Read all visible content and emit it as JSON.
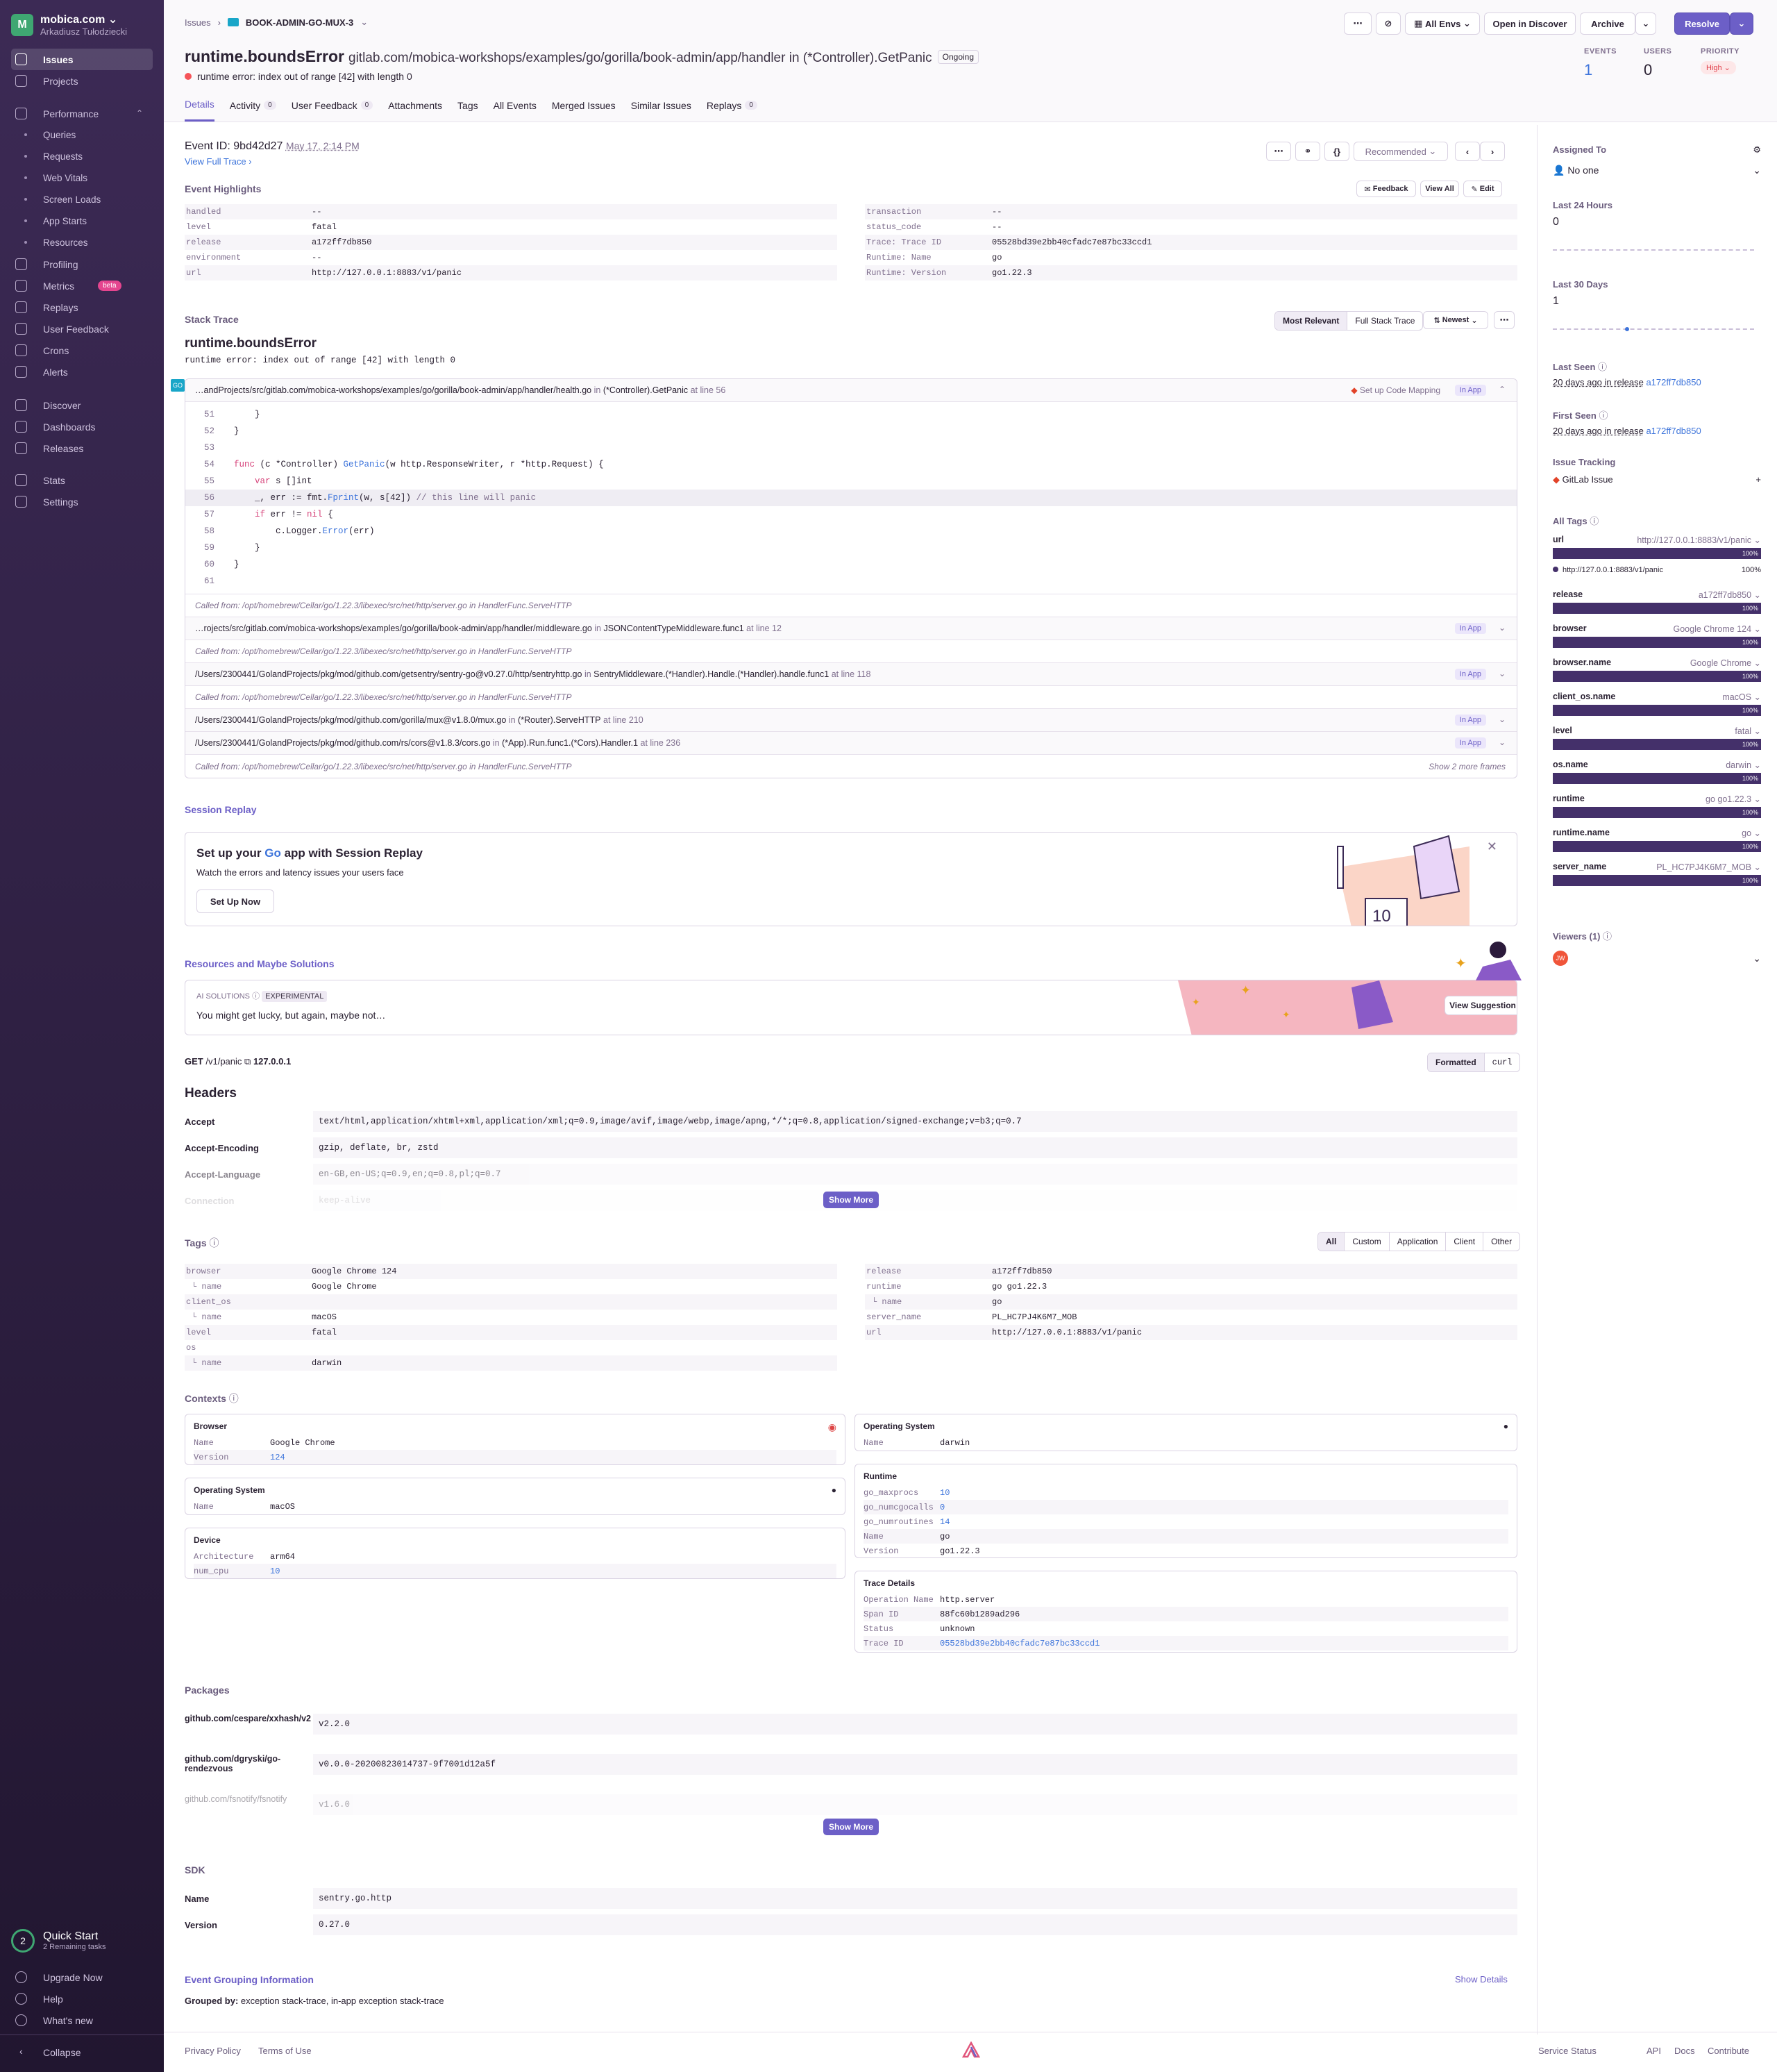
{
  "org": {
    "initial": "M",
    "name": "mobica.com",
    "user": "Arkadiusz Tułodziecki"
  },
  "nav": {
    "issues": "Issues",
    "projects": "Projects",
    "performance": "Performance",
    "queries": "Queries",
    "requests": "Requests",
    "web_vitals": "Web Vitals",
    "screen_loads": "Screen Loads",
    "app_starts": "App Starts",
    "resources": "Resources",
    "profiling": "Profiling",
    "metrics": "Metrics",
    "beta": "beta",
    "replays": "Replays",
    "user_feedback": "User Feedback",
    "crons": "Crons",
    "alerts": "Alerts",
    "discover": "Discover",
    "dashboards": "Dashboards",
    "releases": "Releases",
    "stats": "Stats",
    "settings": "Settings",
    "upgrade": "Upgrade Now",
    "help": "Help",
    "whats_new": "What's new",
    "collapse": "Collapse"
  },
  "quickstart": {
    "count": "2",
    "title": "Quick Start",
    "sub": "2 Remaining tasks"
  },
  "breadcrumb": {
    "issues": "Issues",
    "project": "BOOK-ADMIN-GO-MUX-3"
  },
  "toolbar": {
    "envs": "All Envs",
    "discover": "Open in Discover",
    "archive": "Archive",
    "resolve": "Resolve"
  },
  "issue": {
    "title": "runtime.boundsError",
    "culprit": "gitlab.com/mobica-workshops/examples/go/gorilla/book-admin/app/handler in (*Controller).GetPanic",
    "status": "Ongoing",
    "message": "runtime error: index out of range [42] with length 0"
  },
  "stats": {
    "events_label": "EVENTS",
    "events": "1",
    "users_label": "USERS",
    "users": "0",
    "priority_label": "PRIORITY",
    "priority": "High"
  },
  "tabs": [
    {
      "label": "Details"
    },
    {
      "label": "Activity",
      "count": "0"
    },
    {
      "label": "User Feedback",
      "count": "0"
    },
    {
      "label": "Attachments"
    },
    {
      "label": "Tags"
    },
    {
      "label": "All Events"
    },
    {
      "label": "Merged Issues"
    },
    {
      "label": "Similar Issues"
    },
    {
      "label": "Replays",
      "count": "0"
    }
  ],
  "event": {
    "id_label": "Event ID:",
    "id": "9bd42d27",
    "date": "May 17, 2:14 PM",
    "full_trace": "View Full Trace",
    "recommended": "Recommended"
  },
  "highlights": {
    "title": "Event Highlights",
    "feedback": "Feedback",
    "view_all": "View All",
    "edit": "Edit",
    "left": [
      [
        "handled",
        "--"
      ],
      [
        "level",
        "fatal"
      ],
      [
        "release",
        "a172ff7db850"
      ],
      [
        "environment",
        "--"
      ],
      [
        "url",
        "http://127.0.0.1:8883/v1/panic"
      ]
    ],
    "right": [
      [
        "transaction",
        "--"
      ],
      [
        "status_code",
        "--"
      ],
      [
        "Trace: Trace ID",
        "05528bd39e2bb40cfadc7e87bc33ccd1"
      ],
      [
        "Runtime: Name",
        "go"
      ],
      [
        "Runtime: Version",
        "go1.22.3"
      ]
    ]
  },
  "stack": {
    "title": "Stack Trace",
    "most_relevant": "Most Relevant",
    "full": "Full Stack Trace",
    "newest": "Newest",
    "exc_type": "runtime.boundsError",
    "exc_value": "runtime error: index out of range [42] with length 0",
    "frame1": {
      "path": "…andProjects/src/gitlab.com/mobica-workshops/examples/go/gorilla/book-admin/app/handler/health.go",
      "fn": "(*Controller).GetPanic",
      "line": "at line 56",
      "mapping": "Set up Code Mapping",
      "inapp": "In App"
    },
    "lines": [
      [
        "51",
        "    }"
      ],
      [
        "52",
        "}"
      ],
      [
        "53",
        ""
      ],
      [
        "54",
        "func (c *Controller) GetPanic(w http.ResponseWriter, r *http.Request) {"
      ],
      [
        "55",
        "    var s []int"
      ],
      [
        "56",
        "    _, err := fmt.Fprint(w, s[42]) // this line will panic"
      ],
      [
        "57",
        "    if err != nil {"
      ],
      [
        "58",
        "        c.Logger.Error(err)"
      ],
      [
        "59",
        "    }"
      ],
      [
        "60",
        "}"
      ],
      [
        "61",
        ""
      ]
    ],
    "called1": "Called from: /opt/homebrew/Cellar/go/1.22.3/libexec/src/net/http/server.go  in  HandlerFunc.ServeHTTP",
    "frame2": {
      "path": "…rojects/src/gitlab.com/mobica-workshops/examples/go/gorilla/book-admin/app/handler/middleware.go",
      "fn": "JSONContentTypeMiddleware.func1",
      "line": "at line 12"
    },
    "called2": "Called from: /opt/homebrew/Cellar/go/1.22.3/libexec/src/net/http/server.go  in  HandlerFunc.ServeHTTP",
    "frame3": {
      "path": "/Users/2300441/GolandProjects/pkg/mod/github.com/getsentry/sentry-go@v0.27.0/http/sentryhttp.go",
      "fn": "SentryMiddleware.(*Handler).Handle.(*Handler).handle.func1",
      "line": "at line 118"
    },
    "called3": "Called from: /opt/homebrew/Cellar/go/1.22.3/libexec/src/net/http/server.go  in  HandlerFunc.ServeHTTP",
    "frame4": {
      "path": "/Users/2300441/GolandProjects/pkg/mod/github.com/gorilla/mux@v1.8.0/mux.go",
      "fn": "(*Router).ServeHTTP",
      "line": "at line 210"
    },
    "frame5": {
      "path": "/Users/2300441/GolandProjects/pkg/mod/github.com/rs/cors@v1.8.3/cors.go",
      "fn": "(*App).Run.func1.(*Cors).Handler.1",
      "line": "at line 236"
    },
    "called4": "Called from: /opt/homebrew/Cellar/go/1.22.3/libexec/src/net/http/server.go  in  HandlerFunc.ServeHTTP",
    "show_more": "Show 2 more frames"
  },
  "replay": {
    "title": "Session Replay",
    "head_a": "Set up your ",
    "head_go": "Go",
    "head_b": " app with Session Replay",
    "sub": "Watch the errors and latency issues your users face",
    "btn": "Set Up Now",
    "num": "10"
  },
  "solutions": {
    "title": "Resources and Maybe Solutions",
    "ai": "AI SOLUTIONS",
    "exp": "EXPERIMENTAL",
    "text": "You might get lucky, but again, maybe not…",
    "btn": "View Suggestion"
  },
  "request": {
    "method": "GET",
    "path": "/v1/panic",
    "host": "127.0.0.1",
    "formatted": "Formatted",
    "curl": "curl",
    "headers": "Headers",
    "rows": [
      [
        "Accept",
        "text/html,application/xhtml+xml,application/xml;q=0.9,image/avif,image/webp,image/apng,*/*;q=0.8,application/signed-exchange;v=b3;q=0.7"
      ],
      [
        "Accept-Encoding",
        "gzip, deflate, br, zstd"
      ],
      [
        "Accept-Language",
        "en-GB,en-US;q=0.9,en;q=0.8,pl;q=0.7"
      ],
      [
        "Connection",
        "keep-alive"
      ]
    ],
    "show_more": "Show More"
  },
  "tags": {
    "title": "Tags",
    "filters": [
      "All",
      "Custom",
      "Application",
      "Client",
      "Other"
    ],
    "left": [
      [
        "browser",
        "Google Chrome 124"
      ],
      [
        "  name",
        "Google Chrome"
      ],
      [
        "client_os",
        ""
      ],
      [
        "  name",
        "macOS"
      ],
      [
        "level",
        "fatal"
      ],
      [
        "os",
        ""
      ],
      [
        "  name",
        "darwin"
      ]
    ],
    "right": [
      [
        "release",
        "a172ff7db850"
      ],
      [
        "runtime",
        "go go1.22.3"
      ],
      [
        "  name",
        "go"
      ],
      [
        "server_name",
        "PL_HC7PJ4K6M7_MOB"
      ],
      [
        "url",
        "http://127.0.0.1:8883/v1/panic"
      ]
    ]
  },
  "contexts": {
    "title": "Contexts",
    "browser": {
      "title": "Browser",
      "rows": [
        [
          "Name",
          "Google Chrome"
        ],
        [
          "Version",
          "124"
        ]
      ]
    },
    "os1": {
      "title": "Operating System",
      "rows": [
        [
          "Name",
          "macOS"
        ]
      ]
    },
    "device": {
      "title": "Device",
      "rows": [
        [
          "Architecture",
          "arm64"
        ],
        [
          "num_cpu",
          "10"
        ]
      ]
    },
    "os2": {
      "title": "Operating System",
      "rows": [
        [
          "Name",
          "darwin"
        ]
      ]
    },
    "runtime": {
      "title": "Runtime",
      "rows": [
        [
          "go_maxprocs",
          "10"
        ],
        [
          "go_numcgocalls",
          "0"
        ],
        [
          "go_numroutines",
          "14"
        ],
        [
          "Name",
          "go"
        ],
        [
          "Version",
          "go1.22.3"
        ]
      ]
    },
    "trace": {
      "title": "Trace Details",
      "rows": [
        [
          "Operation Name",
          "http.server"
        ],
        [
          "Span ID",
          "88fc60b1289ad296"
        ],
        [
          "Status",
          "unknown"
        ],
        [
          "Trace ID",
          "05528bd39e2bb40cfadc7e87bc33ccd1"
        ]
      ]
    }
  },
  "packages": {
    "title": "Packages",
    "rows": [
      [
        "github.com/cespare/xxhash/v2",
        "v2.2.0"
      ],
      [
        "github.com/dgryski/go-rendezvous",
        "v0.0.0-20200823014737-9f7001d12a5f"
      ],
      [
        "github.com/fsnotify/fsnotify",
        "v1.6.0"
      ]
    ],
    "show_more": "Show More"
  },
  "sdk": {
    "title": "SDK",
    "rows": [
      [
        "Name",
        "sentry.go.http"
      ],
      [
        "Version",
        "0.27.0"
      ]
    ]
  },
  "grouping": {
    "title": "Event Grouping Information",
    "show": "Show Details",
    "label": "Grouped by:",
    "value": "exception stack-trace, in-app exception stack-trace"
  },
  "right": {
    "assigned": "Assigned To",
    "no_one": "No one",
    "last24": "Last 24 Hours",
    "last24v": "0",
    "last30": "Last 30 Days",
    "last30v": "1",
    "last_seen": "Last Seen",
    "last_seen_v": "20 days ago in release",
    "first_seen": "First Seen",
    "first_seen_v": "20 days ago in release",
    "release": "a172ff7db850",
    "tracking": "Issue Tracking",
    "gitlab": "GitLab Issue",
    "all_tags": "All Tags",
    "url_value": "http://127.0.0.1:8883/v1/panic",
    "pct": "100%",
    "viewers": "Viewers (1)",
    "viewer_initials": "JW",
    "tags": [
      [
        "url",
        "http://127.0.0.1:8883/v1/panic"
      ],
      [
        "release",
        "a172ff7db850"
      ],
      [
        "browser",
        "Google Chrome 124"
      ],
      [
        "browser.name",
        "Google Chrome"
      ],
      [
        "client_os.name",
        "macOS"
      ],
      [
        "level",
        "fatal"
      ],
      [
        "os.name",
        "darwin"
      ],
      [
        "runtime",
        "go go1.22.3"
      ],
      [
        "runtime.name",
        "go"
      ],
      [
        "server_name",
        "PL_HC7PJ4K6M7_MOB"
      ]
    ]
  },
  "footer": {
    "privacy": "Privacy Policy",
    "terms": "Terms of Use",
    "status": "Service Status",
    "api": "API",
    "docs": "Docs",
    "contribute": "Contribute"
  },
  "colors": {
    "accent": "#6c5fc7",
    "sidebar": "#2c1e3f",
    "tagbar": "#44306a",
    "danger": "#f55459"
  }
}
